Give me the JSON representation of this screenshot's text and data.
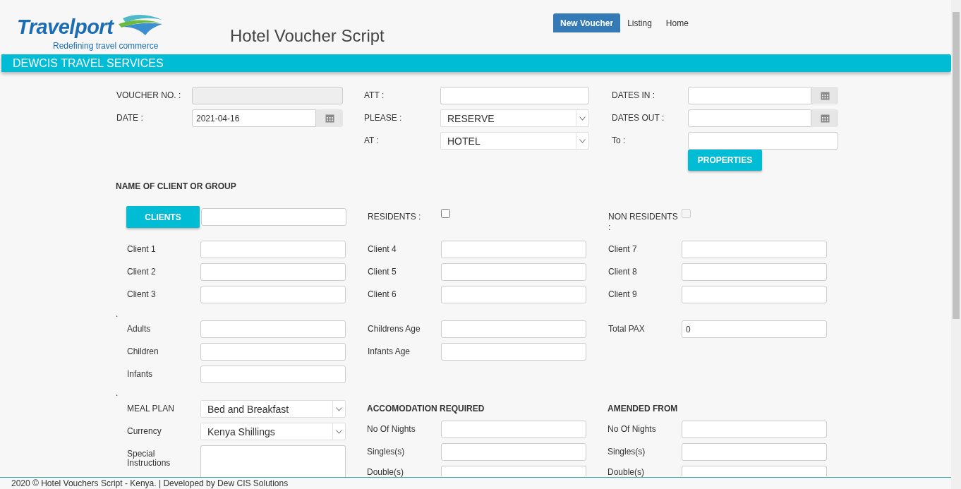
{
  "logo": {
    "wordmark": "Travelport",
    "tagline": "Redefining travel commerce"
  },
  "app_title": "Hotel Voucher Script",
  "nav": [
    {
      "label": "New Voucher",
      "selected": true
    },
    {
      "label": "Listing",
      "selected": false
    },
    {
      "label": "Home",
      "selected": false
    }
  ],
  "banner": "DEWCIS TRAVEL SERVICES",
  "voucher_columns": [
    [
      {
        "label": "VOUCHER NO. :",
        "kind": "readonly"
      },
      {
        "label": "DATE :",
        "kind": "date",
        "value": "2021-04-16"
      }
    ],
    [
      {
        "label": "ATT :",
        "kind": "text"
      },
      {
        "label": "PLEASE :",
        "kind": "select",
        "value": "RESERVE"
      },
      {
        "label": "AT :",
        "kind": "select",
        "value": "HOTEL"
      }
    ],
    [
      {
        "label": "DATES IN :",
        "kind": "date"
      },
      {
        "label": "DATES OUT :",
        "kind": "date"
      },
      {
        "label": "To :",
        "kind": "text"
      }
    ]
  ],
  "properties_button": "PROPERTIES",
  "client_heading": "NAME OF CLIENT OR GROUP",
  "clients_button": "CLIENTS",
  "residents": {
    "label": "RESIDENTS :",
    "checked": false,
    "disabled": false
  },
  "non_residents": {
    "label": "NON RESIDENTS :",
    "checked": false,
    "disabled": true
  },
  "client_columns": [
    [
      {
        "label": "Client 1",
        "kind": "text"
      },
      {
        "label": "Client 2",
        "kind": "text"
      },
      {
        "label": "Client 3",
        "kind": "text"
      }
    ],
    [
      {
        "label": "Client 4",
        "kind": "text"
      },
      {
        "label": "Client 5",
        "kind": "text"
      },
      {
        "label": "Client 6",
        "kind": "text"
      }
    ],
    [
      {
        "label": "Client 7",
        "kind": "text"
      },
      {
        "label": "Client 8",
        "kind": "text"
      },
      {
        "label": "Client 9",
        "kind": "text"
      }
    ]
  ],
  "separator_1": ".",
  "pax_columns": [
    [
      {
        "label": "Adults",
        "kind": "text"
      },
      {
        "label": "Children",
        "kind": "text"
      },
      {
        "label": "Infants",
        "kind": "text"
      }
    ],
    [
      {
        "label": "Childrens Age",
        "kind": "text"
      },
      {
        "label": "Infants Age",
        "kind": "text"
      }
    ],
    [
      {
        "label": "Total PAX",
        "kind": "text",
        "value": "0"
      }
    ]
  ],
  "separator_2": ".",
  "meal_fields": [
    {
      "label": "MEAL PLAN",
      "kind": "select",
      "value": "Bed and Breakfast"
    },
    {
      "label": "Currency",
      "kind": "select",
      "value": "Kenya Shillings"
    },
    {
      "label": "Special Instructions",
      "kind": "textarea"
    }
  ],
  "accommodation": {
    "heading": "ACCOMODATION REQUIRED",
    "fields": [
      {
        "label": "No Of Nights",
        "kind": "text"
      },
      {
        "label": "Singles(s)",
        "kind": "text"
      },
      {
        "label": "Double(s)",
        "kind": "text"
      }
    ]
  },
  "amended": {
    "heading": "AMENDED FROM",
    "fields": [
      {
        "label": "No Of Nights",
        "kind": "text"
      },
      {
        "label": "Singles(s)",
        "kind": "text"
      },
      {
        "label": "Double(s)",
        "kind": "text"
      }
    ]
  },
  "footer": "2020 © Hotel Vouchers Script - Kenya. | Developed by Dew CIS Solutions"
}
